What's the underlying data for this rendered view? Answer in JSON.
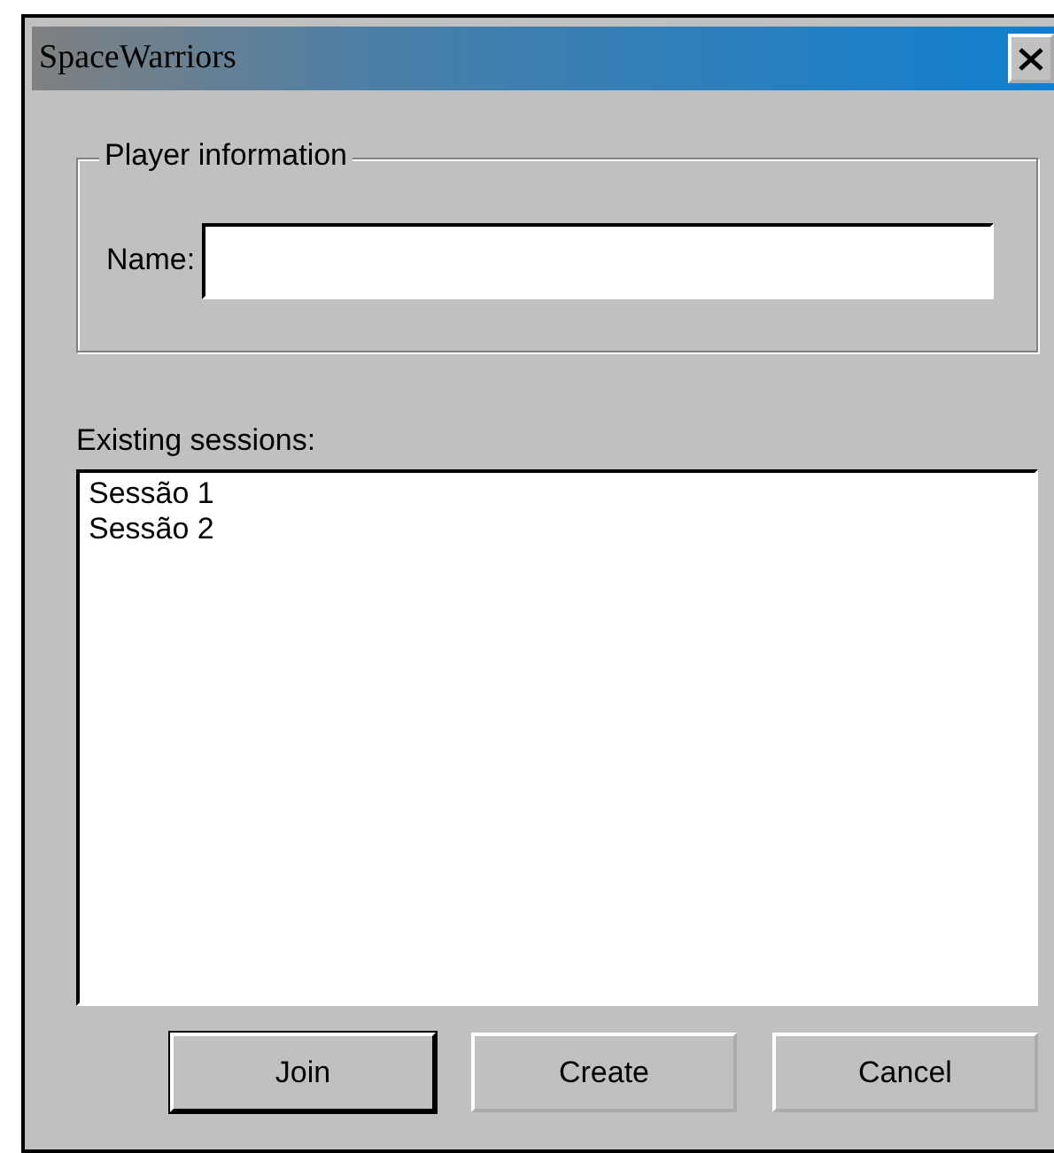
{
  "window": {
    "title": "SpaceWarriors"
  },
  "player_information": {
    "legend": "Player information",
    "name_label": "Name:"
  },
  "sessions": {
    "label": "Existing sessions:",
    "items": [
      {
        "label": "Sessão 1",
        "selected": false
      },
      {
        "label": "Sessão 2",
        "selected": false
      }
    ]
  },
  "buttons": [
    {
      "label": "Join",
      "default": true
    },
    {
      "label": "Create",
      "default": false
    },
    {
      "label": "Cancel",
      "default": false
    }
  ]
}
